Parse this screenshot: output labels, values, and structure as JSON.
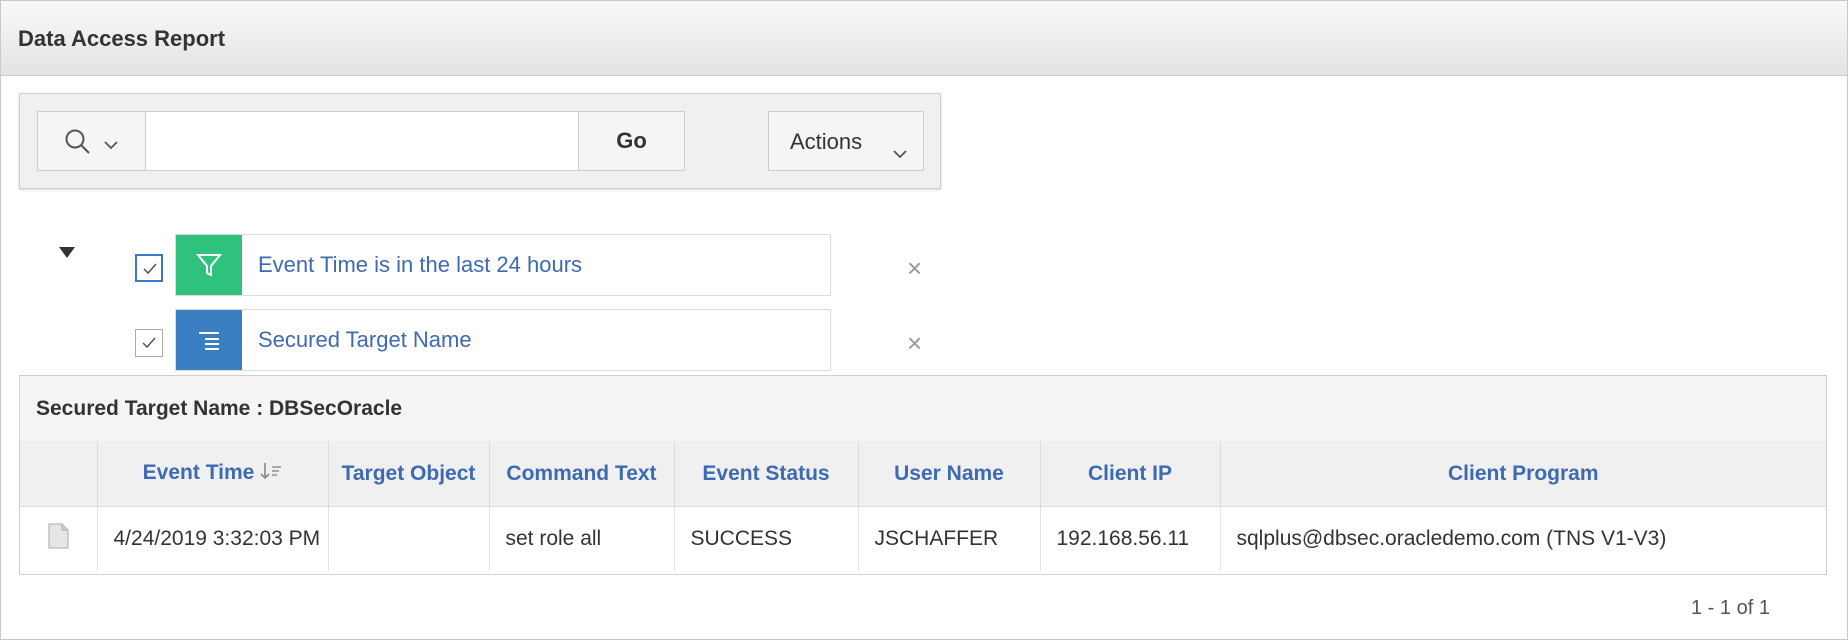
{
  "region": {
    "title": "Data Access Report"
  },
  "search": {
    "value": "",
    "go_label": "Go",
    "actions_label": "Actions"
  },
  "filters": [
    {
      "text": "Event Time is in the last 24 hours",
      "enabled": true,
      "type": "filter",
      "color": "#2ec27e"
    },
    {
      "text": "Secured Target Name",
      "enabled": true,
      "type": "control-break",
      "color": "#3a7fc1"
    }
  ],
  "control_break": {
    "label": "Secured Target Name : DBSecOracle"
  },
  "table": {
    "columns": [
      "Event Time",
      "Target Object",
      "Command Text",
      "Event Status",
      "User Name",
      "Client IP",
      "Client Program"
    ],
    "rows": [
      {
        "Event Time": "4/24/2019 3:32:03 PM",
        "Target Object": "",
        "Command Text": "set role all",
        "Event Status": "SUCCESS",
        "User Name": "JSCHAFFER",
        "Client IP": "192.168.56.11",
        "Client Program": "sqlplus@dbsec.oracledemo.com (TNS V1-V3)"
      }
    ]
  },
  "pagination": {
    "text": "1 - 1 of 1"
  },
  "icons": {
    "search": "search-icon",
    "filter": "filter-funnel-icon",
    "control_break": "control-break-icon",
    "row_detail": "document-icon",
    "remove": "close-icon",
    "sort": "sort-descending-icon"
  }
}
